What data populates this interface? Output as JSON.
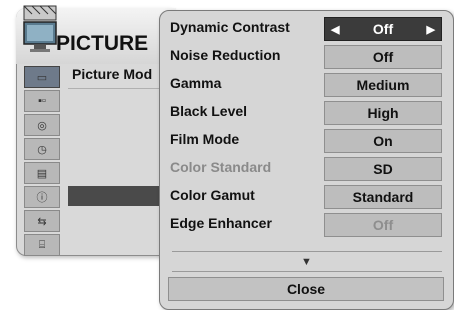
{
  "background_menu": {
    "title": "PICTURE",
    "item": "Picture Mod",
    "icons": [
      "picture-icon",
      "audio-icon",
      "time-icon",
      "clock-icon",
      "option-icon",
      "info-icon",
      "input-icon",
      "usb-icon"
    ]
  },
  "popup": {
    "rows": [
      {
        "label": "Dynamic Contrast",
        "value": "Off",
        "state": "active"
      },
      {
        "label": "Noise Reduction",
        "value": "Off",
        "state": "normal"
      },
      {
        "label": "Gamma",
        "value": "Medium",
        "state": "normal"
      },
      {
        "label": "Black Level",
        "value": "High",
        "state": "normal"
      },
      {
        "label": "Film Mode",
        "value": "On",
        "state": "normal"
      },
      {
        "label": "Color Standard",
        "value": "SD",
        "state": "label-dim"
      },
      {
        "label": "Color Gamut",
        "value": "Standard",
        "state": "normal"
      },
      {
        "label": "Edge Enhancer",
        "value": "Off",
        "state": "value-dim"
      }
    ],
    "scroll_down_symbol": "▼",
    "close_label": "Close",
    "left_arrow": "◀",
    "right_arrow": "▶"
  }
}
